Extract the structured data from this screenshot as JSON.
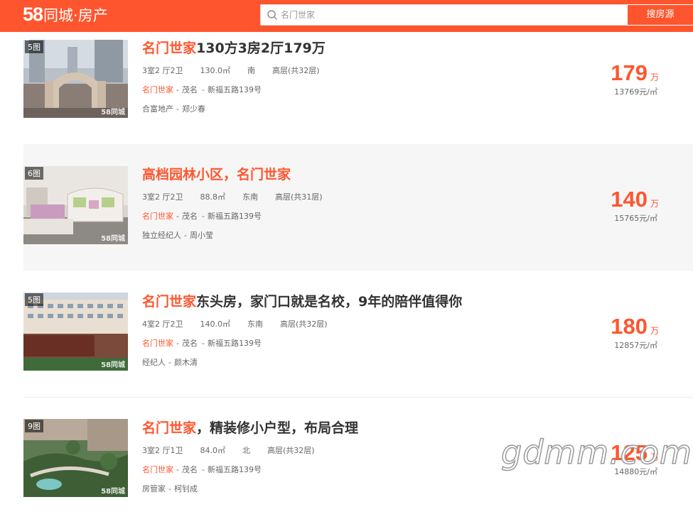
{
  "header": {
    "logo_num": "58",
    "logo_text": "同城·房产",
    "search_placeholder": "名门世家",
    "search_button": "搜房源"
  },
  "listings": [
    {
      "pic_count": "5图",
      "title_highlight": "名门世家",
      "title_rest": "130方3房2厅179万",
      "layout": "3室2 厅2卫",
      "area": "130.0㎡",
      "orientation": "南",
      "floor": "高层(共32层)",
      "estate": "名门世家",
      "district": "茂名",
      "address": "新福五路139号",
      "agency": "合富地产",
      "agent": "郑少春",
      "price": "179",
      "price_unit": "万",
      "unit_price": "13769元/㎡",
      "image_watermark": "58同城"
    },
    {
      "pic_count": "6图",
      "title_highlight": "",
      "title_rest": "高档园林小区，名门世家",
      "layout": "3室2 厅2卫",
      "area": "88.8㎡",
      "orientation": "东南",
      "floor": "高层(共31层)",
      "estate": "名门世家",
      "district": "茂名",
      "address": "新福五路139号",
      "agency": "独立经纪人",
      "agent": "周小莹",
      "price": "140",
      "price_unit": "万",
      "unit_price": "15765元/㎡",
      "image_watermark": "58同城"
    },
    {
      "pic_count": "5图",
      "title_highlight": "名门世家",
      "title_rest": "东头房，家门口就是名校，9年的陪伴值得你",
      "layout": "4室2 厅2卫",
      "area": "140.0㎡",
      "orientation": "东南",
      "floor": "高层(共32层)",
      "estate": "名门世家",
      "district": "茂名",
      "address": "新福五路139号",
      "agency": "经纪人",
      "agent": "颜木清",
      "price": "180",
      "price_unit": "万",
      "unit_price": "12857元/㎡",
      "image_watermark": "58同城"
    },
    {
      "pic_count": "9图",
      "title_highlight": "名门世家",
      "title_rest": "，精装修小户型，布局合理",
      "layout": "3室2 厅1卫",
      "area": "84.0㎡",
      "orientation": "北",
      "floor": "高层(共32层)",
      "estate": "名门世家",
      "district": "茂名",
      "address": "新福五路139号",
      "agency": "房管家",
      "agent": "柯钊成",
      "price": "125",
      "price_unit": "万",
      "unit_price": "14880元/㎡",
      "image_watermark": "58同城"
    }
  ],
  "watermark": "gdmm.com",
  "colors": {
    "brand": "#ff552e",
    "alt_row": "#f6f6f6"
  }
}
